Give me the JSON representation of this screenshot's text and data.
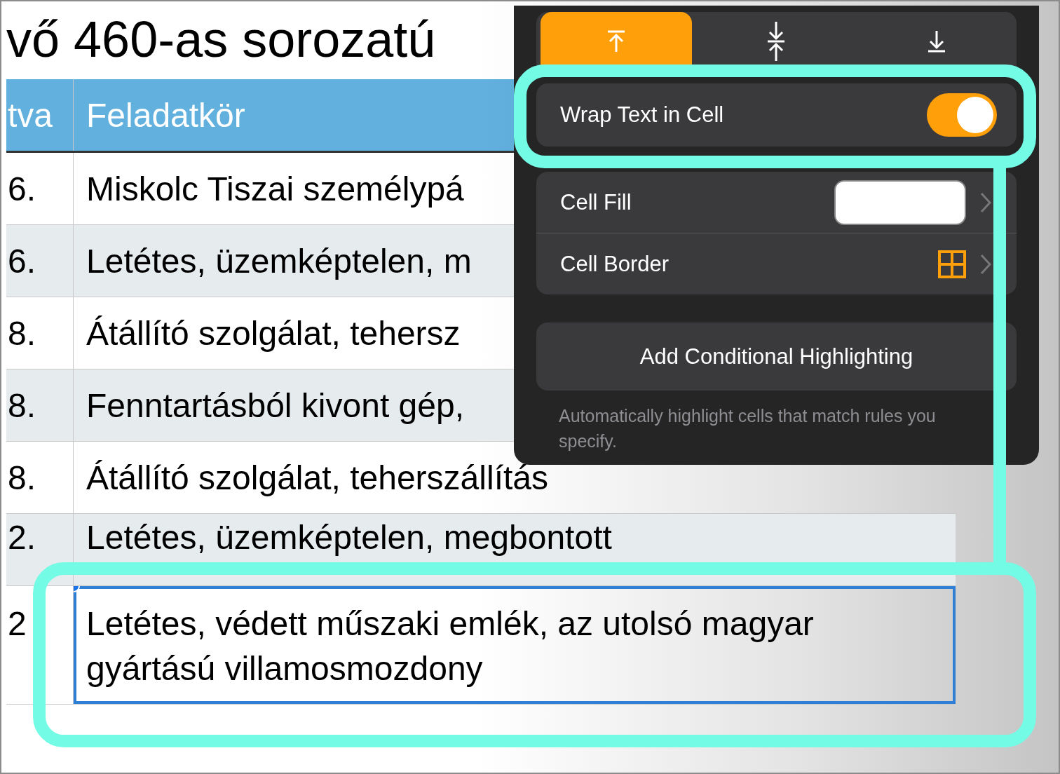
{
  "sheet": {
    "title": "vő 460-as sorozatú",
    "columns": [
      "tva",
      "Feladatkör"
    ],
    "rows": [
      {
        "cells": [
          "6.",
          "Miskolc Tiszai személypá"
        ],
        "selected": false
      },
      {
        "cells": [
          "6.",
          "Letétes, üzemképtelen, m"
        ],
        "selected": false
      },
      {
        "cells": [
          "8.",
          "Átállító szolgálat, tehersz"
        ],
        "selected": false
      },
      {
        "cells": [
          "8.",
          "Fenntartásból kivont gép,"
        ],
        "selected": false
      },
      {
        "cells": [
          "8.",
          "Átállító szolgálat, teherszállítás"
        ],
        "selected": false
      },
      {
        "cells": [
          "2.",
          "Letétes, üzemképtelen, megbontott"
        ],
        "selected": false
      },
      {
        "cells": [
          "2",
          "Letétes, védett műszaki emlék, az utolsó magyar gyártású villamosmozdony"
        ],
        "selected": true
      }
    ]
  },
  "popover": {
    "alignment": [
      {
        "kind": "top",
        "selected": true
      },
      {
        "kind": "middle",
        "selected": false
      },
      {
        "kind": "bottom",
        "selected": false
      }
    ],
    "wrap_text": {
      "label": "Wrap Text in Cell",
      "on": true
    },
    "cell_fill": {
      "label": "Cell Fill"
    },
    "cell_border": {
      "label": "Cell Border"
    },
    "button": "Add Conditional Highlighting",
    "footnote": "Automatically highlight cells that match rules you specify."
  }
}
